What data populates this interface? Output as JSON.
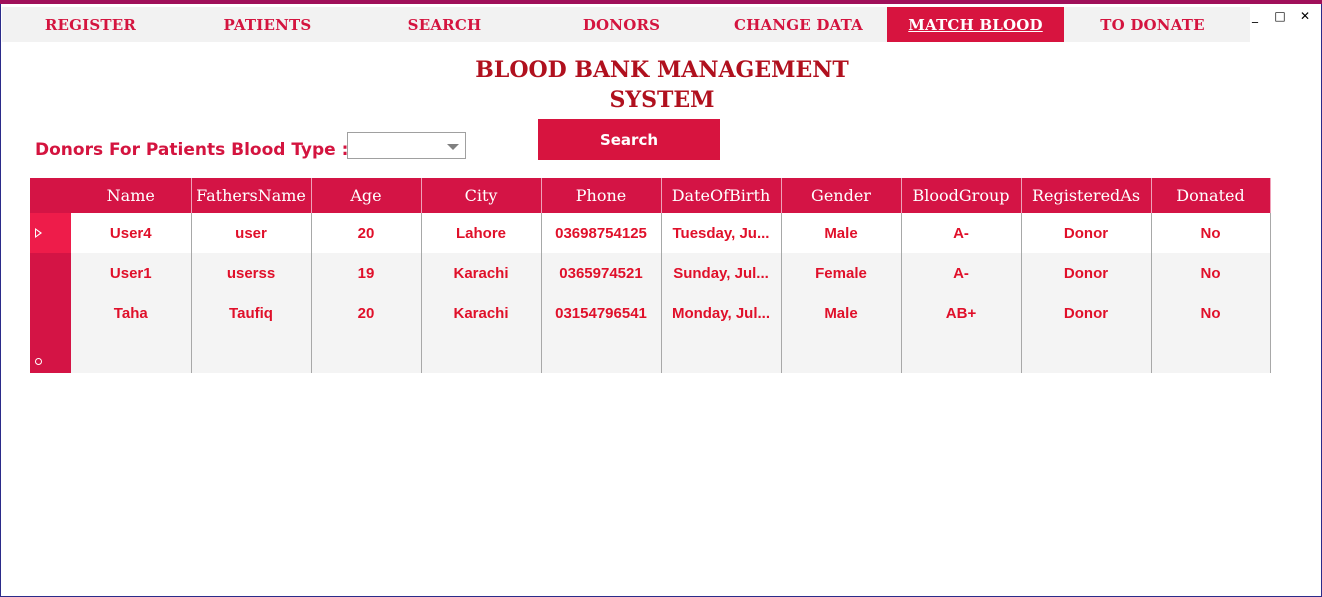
{
  "tabs": [
    {
      "label": "REGISTER"
    },
    {
      "label": "PATIENTS"
    },
    {
      "label": "SEARCH"
    },
    {
      "label": "DONORS"
    },
    {
      "label": "CHANGE DATA"
    },
    {
      "label": "MATCH BLOOD",
      "active": true
    },
    {
      "label": "TO DONATE"
    }
  ],
  "window": {
    "minimize": "_",
    "maximize": "□",
    "close": "✕"
  },
  "title": {
    "line1": "BLOOD BANK MANAGEMENT",
    "line2": "SYSTEM"
  },
  "filter": {
    "label": "Donors For Patients Blood Type :",
    "value": ""
  },
  "search_button": "Search",
  "grid": {
    "columns": [
      "Name",
      "FathersName",
      "Age",
      "City",
      "Phone",
      "DateOfBirth",
      "Gender",
      "BloodGroup",
      "RegisteredAs",
      "Donated"
    ],
    "rows": [
      [
        "User4",
        "user",
        "20",
        "Lahore",
        "03698754125",
        "Tuesday, Ju...",
        "Male",
        "A-",
        "Donor",
        "No"
      ],
      [
        "User1",
        "userss",
        "19",
        "Karachi",
        "0365974521",
        "Sunday, Jul...",
        "Female",
        "A-",
        "Donor",
        "No"
      ],
      [
        "Taha",
        "Taufiq",
        "20",
        "Karachi",
        "03154796541",
        "Monday, Jul...",
        "Male",
        "AB+",
        "Donor",
        "No"
      ]
    ]
  },
  "colors": {
    "accent": "#d7143f",
    "title": "#b0101e",
    "cell_text": "#e0102a"
  }
}
